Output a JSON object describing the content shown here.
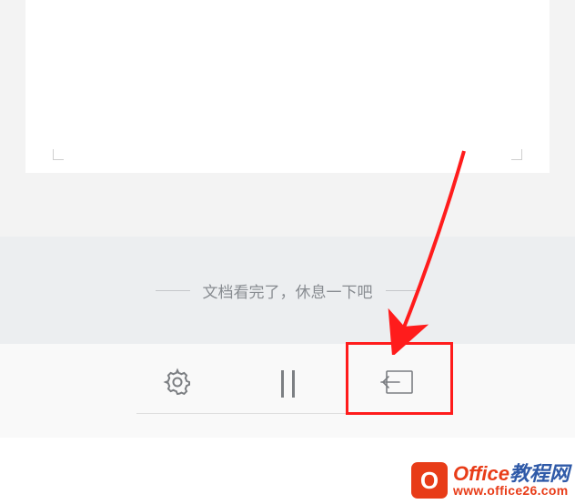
{
  "document": {
    "end_message": "文档看完了，休息一下吧"
  },
  "toolbar": {
    "settings_label": "settings",
    "page_label": "page-indicator",
    "exit_label": "exit"
  },
  "watermark": {
    "logo_letter": "O",
    "title_part1": "Office",
    "title_part2": "教程网",
    "url": "www.office26.com"
  }
}
